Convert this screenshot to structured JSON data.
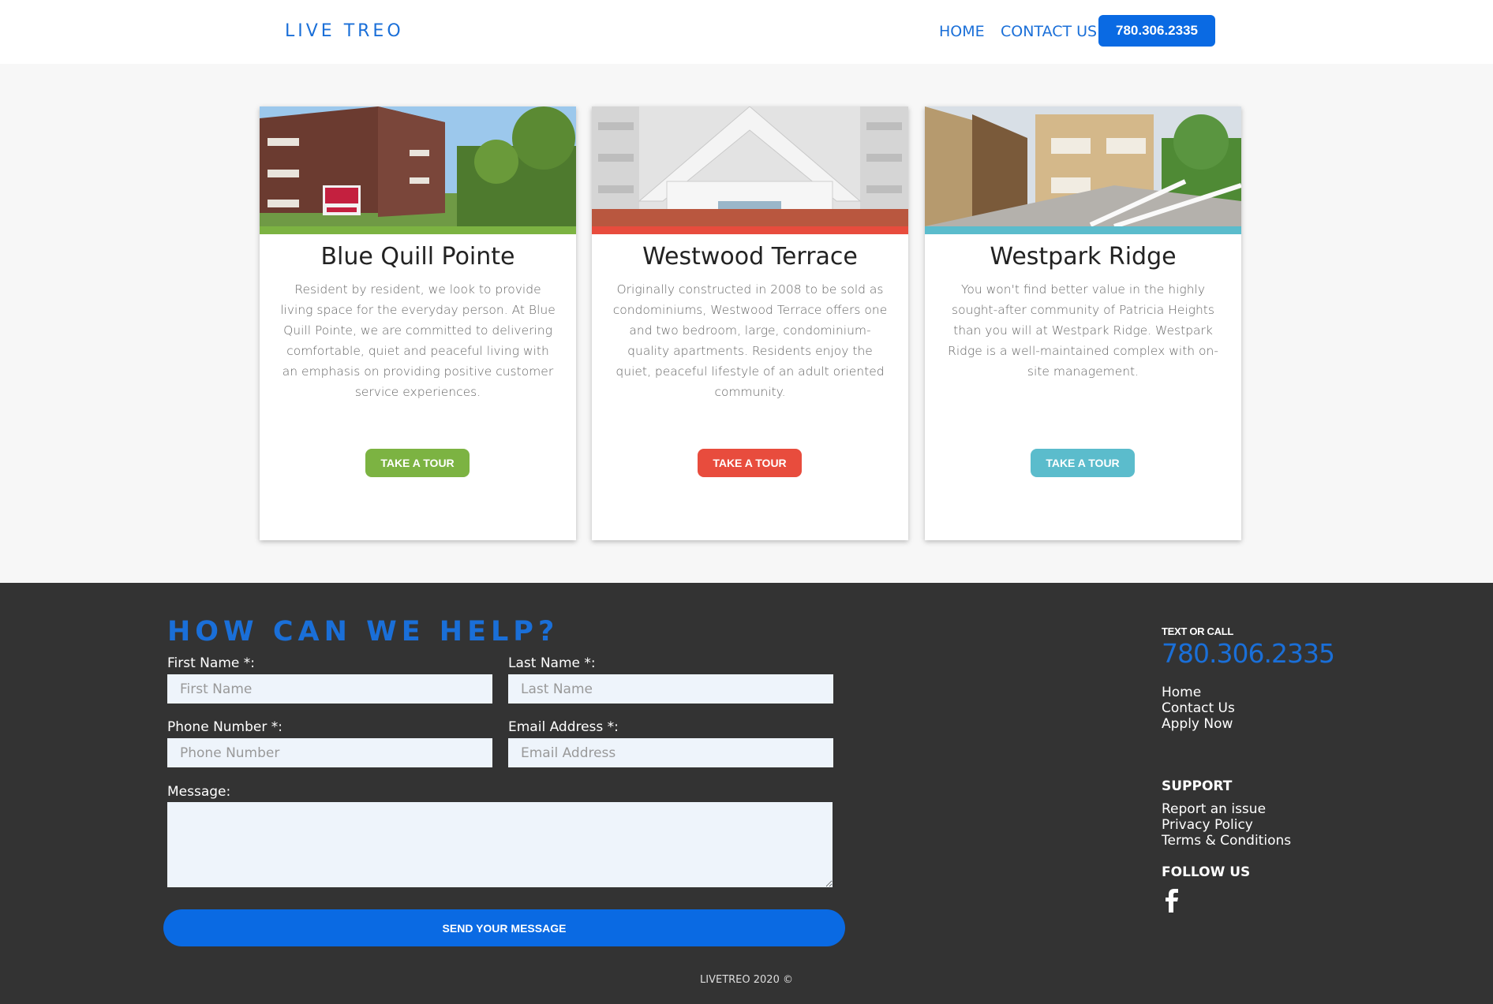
{
  "header": {
    "logo": "LIVE TREO",
    "nav": {
      "home": "HOME",
      "contact": "CONTACT US"
    },
    "phone_button": "780.306.2335"
  },
  "cards": [
    {
      "title": "Blue Quill Pointe",
      "text": "Resident by resident, we look to provide living space for the everyday person. At Blue Quill Pointe, we are committed to delivering comfortable, quiet and peaceful living with an emphasis on providing positive customer service experiences.",
      "button": "TAKE A TOUR",
      "accent": "#7cb342"
    },
    {
      "title": "Westwood Terrace",
      "text": "Originally constructed in 2008 to be sold as condominiums, Westwood Terrace offers one and two bedroom, large, condominium-quality apartments. Residents enjoy the quiet, peaceful lifestyle of an adult oriented community.",
      "button": "TAKE A TOUR",
      "accent": "#e84c3d"
    },
    {
      "title": "Westpark Ridge",
      "text": "You won't find better value in the highly sought-after community of Patricia Heights than you will at Westpark Ridge. Westpark Ridge is a well-maintained complex with on-site management.",
      "button": "TAKE A TOUR",
      "accent": "#5bbccc"
    }
  ],
  "form": {
    "title": "HOW CAN WE HELP?",
    "first_name": {
      "label": "First Name *:",
      "placeholder": "First Name"
    },
    "last_name": {
      "label": "Last Name *:",
      "placeholder": "Last Name"
    },
    "phone": {
      "label": "Phone Number *:",
      "placeholder": "Phone Number"
    },
    "email": {
      "label": "Email Address *:",
      "placeholder": "Email Address"
    },
    "message": {
      "label": "Message:"
    },
    "submit": "SEND YOUR MESSAGE"
  },
  "sidebar": {
    "text_or_call": "TEXT OR CALL",
    "phone": "780.306.2335",
    "links": [
      "Home",
      "Contact Us",
      "Apply Now"
    ],
    "support_title": "SUPPORT",
    "support_links": [
      "Report an issue",
      "Privacy Policy",
      "Terms & Conditions"
    ],
    "follow_title": "FOLLOW US",
    "social_icon": "facebook-icon"
  },
  "copyright": "LIVETREO 2020 ©",
  "colors": {
    "brand_blue": "#1a6fd8",
    "button_blue": "#0a6ae3",
    "footer_bg": "#333333"
  }
}
